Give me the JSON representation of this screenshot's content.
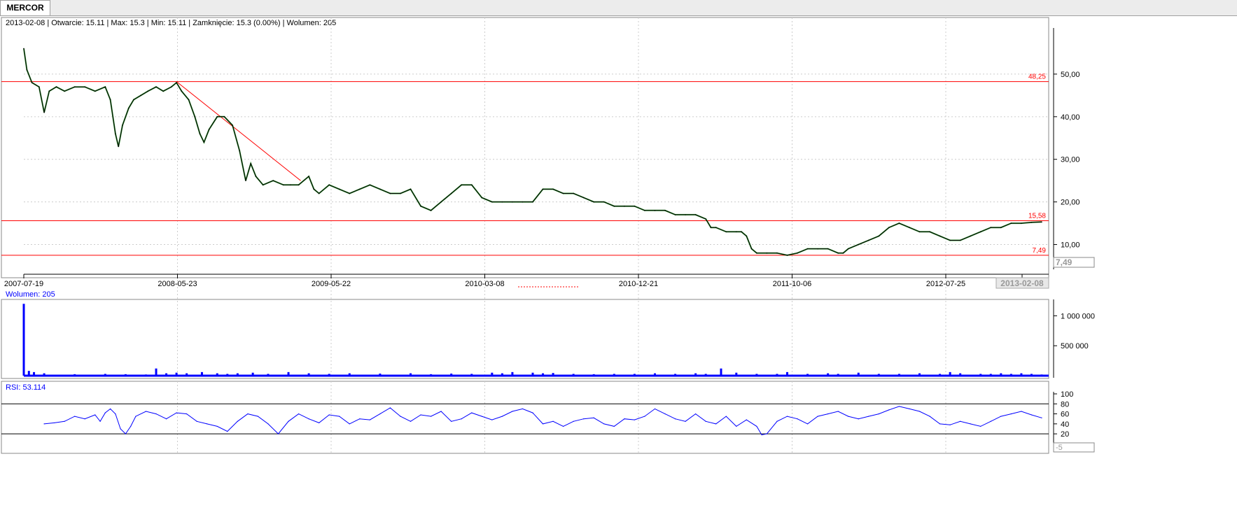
{
  "window": {
    "tab": "MERCOR"
  },
  "info": "2013-02-08 | Otwarcie: 15.11 | Max: 15.3 | Min: 15.11 | Zamknięcie: 15.3 (0.00%)  | Wolumen: 205",
  "colors": {
    "price": "#000000",
    "avg": "#008000",
    "hline": "#ff0000",
    "volume": "#0000ff",
    "rsi": "#0000ff"
  },
  "chart_data": [
    {
      "type": "line",
      "title": "",
      "x_ticks": [
        "2007-07-19",
        "2008-05-23",
        "2009-05-22",
        "2010-03-08",
        "2010-12-21",
        "2011-10-06",
        "2012-07-25",
        "2013-02-08"
      ],
      "ylim": [
        5,
        60
      ],
      "y_ticks": [
        {
          "value": 10,
          "label": "10,00"
        },
        {
          "value": 20,
          "label": "20,00"
        },
        {
          "value": 30,
          "label": "30,00"
        },
        {
          "value": 40,
          "label": "40,00"
        },
        {
          "value": 50,
          "label": "50,00"
        }
      ],
      "current_value_label": "7,49",
      "date_label": "2013-02-08",
      "hlines": [
        {
          "value": 48.25,
          "label": "48,25"
        },
        {
          "value": 15.58,
          "label": "15,58"
        },
        {
          "value": 7.49,
          "label": "7,49"
        }
      ],
      "trendline": {
        "from": [
          0.15,
          48.25
        ],
        "to": [
          0.272,
          25.0
        ]
      },
      "series": [
        {
          "values": [
            [
              0.0,
              56
            ],
            [
              0.003,
              51
            ],
            [
              0.008,
              48
            ],
            [
              0.015,
              47
            ],
            [
              0.02,
              41
            ],
            [
              0.025,
              46
            ],
            [
              0.032,
              47
            ],
            [
              0.04,
              46
            ],
            [
              0.05,
              47
            ],
            [
              0.06,
              47
            ],
            [
              0.07,
              46
            ],
            [
              0.08,
              47
            ],
            [
              0.085,
              44
            ],
            [
              0.09,
              36
            ],
            [
              0.093,
              33
            ],
            [
              0.097,
              38
            ],
            [
              0.103,
              42
            ],
            [
              0.108,
              44
            ],
            [
              0.115,
              45
            ],
            [
              0.122,
              46
            ],
            [
              0.13,
              47
            ],
            [
              0.137,
              46
            ],
            [
              0.145,
              47
            ],
            [
              0.15,
              48
            ],
            [
              0.155,
              46
            ],
            [
              0.162,
              44
            ],
            [
              0.168,
              40
            ],
            [
              0.173,
              36
            ],
            [
              0.177,
              34
            ],
            [
              0.182,
              37
            ],
            [
              0.19,
              40
            ],
            [
              0.197,
              40
            ],
            [
              0.205,
              38
            ],
            [
              0.212,
              32
            ],
            [
              0.218,
              25
            ],
            [
              0.223,
              29
            ],
            [
              0.228,
              26
            ],
            [
              0.235,
              24
            ],
            [
              0.245,
              25
            ],
            [
              0.255,
              24
            ],
            [
              0.262,
              24
            ],
            [
              0.27,
              24
            ],
            [
              0.28,
              26
            ],
            [
              0.285,
              23
            ],
            [
              0.29,
              22
            ],
            [
              0.3,
              24
            ],
            [
              0.31,
              23
            ],
            [
              0.32,
              22
            ],
            [
              0.33,
              23
            ],
            [
              0.34,
              24
            ],
            [
              0.35,
              23
            ],
            [
              0.36,
              22
            ],
            [
              0.37,
              22
            ],
            [
              0.38,
              23
            ],
            [
              0.39,
              19
            ],
            [
              0.4,
              18
            ],
            [
              0.41,
              20
            ],
            [
              0.42,
              22
            ],
            [
              0.43,
              24
            ],
            [
              0.44,
              24
            ],
            [
              0.45,
              21
            ],
            [
              0.46,
              20
            ],
            [
              0.47,
              20
            ],
            [
              0.48,
              20
            ],
            [
              0.49,
              20
            ],
            [
              0.5,
              20
            ],
            [
              0.51,
              23
            ],
            [
              0.52,
              23
            ],
            [
              0.53,
              22
            ],
            [
              0.54,
              22
            ],
            [
              0.55,
              21
            ],
            [
              0.56,
              20
            ],
            [
              0.57,
              20
            ],
            [
              0.58,
              19
            ],
            [
              0.59,
              19
            ],
            [
              0.6,
              19
            ],
            [
              0.61,
              18
            ],
            [
              0.62,
              18
            ],
            [
              0.63,
              18
            ],
            [
              0.64,
              17
            ],
            [
              0.65,
              17
            ],
            [
              0.66,
              17
            ],
            [
              0.67,
              16
            ],
            [
              0.675,
              14
            ],
            [
              0.68,
              14
            ],
            [
              0.69,
              13
            ],
            [
              0.7,
              13
            ],
            [
              0.705,
              13
            ],
            [
              0.71,
              12
            ],
            [
              0.715,
              9
            ],
            [
              0.72,
              8
            ],
            [
              0.73,
              8
            ],
            [
              0.74,
              8
            ],
            [
              0.75,
              7.5
            ],
            [
              0.76,
              8
            ],
            [
              0.77,
              9
            ],
            [
              0.78,
              9
            ],
            [
              0.79,
              9
            ],
            [
              0.8,
              8
            ],
            [
              0.805,
              8
            ],
            [
              0.81,
              9
            ],
            [
              0.82,
              10
            ],
            [
              0.83,
              11
            ],
            [
              0.84,
              12
            ],
            [
              0.85,
              14
            ],
            [
              0.86,
              15
            ],
            [
              0.87,
              14
            ],
            [
              0.88,
              13
            ],
            [
              0.89,
              13
            ],
            [
              0.9,
              12
            ],
            [
              0.91,
              11
            ],
            [
              0.92,
              11
            ],
            [
              0.93,
              12
            ],
            [
              0.94,
              13
            ],
            [
              0.95,
              14
            ],
            [
              0.96,
              14
            ],
            [
              0.97,
              15
            ],
            [
              0.98,
              15
            ],
            [
              0.99,
              15.2
            ],
            [
              1.0,
              15.3
            ]
          ]
        }
      ]
    },
    {
      "type": "bar",
      "label": "Wolumen: 205",
      "ylim": [
        0,
        1250000
      ],
      "y_ticks": [
        {
          "value": 500000,
          "label": "500 000"
        },
        {
          "value": 1000000,
          "label": "1 000 000"
        }
      ],
      "values": [
        [
          0.0,
          1200000
        ],
        [
          0.005,
          80000
        ],
        [
          0.01,
          60000
        ],
        [
          0.02,
          40000
        ],
        [
          0.05,
          25000
        ],
        [
          0.08,
          30000
        ],
        [
          0.1,
          25000
        ],
        [
          0.12,
          20000
        ],
        [
          0.13,
          120000
        ],
        [
          0.14,
          40000
        ],
        [
          0.15,
          50000
        ],
        [
          0.16,
          40000
        ],
        [
          0.175,
          60000
        ],
        [
          0.19,
          40000
        ],
        [
          0.2,
          30000
        ],
        [
          0.21,
          40000
        ],
        [
          0.225,
          50000
        ],
        [
          0.24,
          30000
        ],
        [
          0.26,
          60000
        ],
        [
          0.28,
          40000
        ],
        [
          0.3,
          30000
        ],
        [
          0.32,
          40000
        ],
        [
          0.35,
          35000
        ],
        [
          0.38,
          40000
        ],
        [
          0.4,
          25000
        ],
        [
          0.42,
          35000
        ],
        [
          0.44,
          30000
        ],
        [
          0.46,
          50000
        ],
        [
          0.47,
          40000
        ],
        [
          0.48,
          60000
        ],
        [
          0.5,
          50000
        ],
        [
          0.51,
          40000
        ],
        [
          0.52,
          45000
        ],
        [
          0.54,
          30000
        ],
        [
          0.56,
          25000
        ],
        [
          0.58,
          30000
        ],
        [
          0.6,
          30000
        ],
        [
          0.62,
          40000
        ],
        [
          0.64,
          30000
        ],
        [
          0.66,
          40000
        ],
        [
          0.67,
          30000
        ],
        [
          0.685,
          120000
        ],
        [
          0.7,
          50000
        ],
        [
          0.72,
          30000
        ],
        [
          0.74,
          30000
        ],
        [
          0.75,
          60000
        ],
        [
          0.77,
          30000
        ],
        [
          0.79,
          40000
        ],
        [
          0.8,
          30000
        ],
        [
          0.82,
          50000
        ],
        [
          0.84,
          30000
        ],
        [
          0.86,
          30000
        ],
        [
          0.88,
          40000
        ],
        [
          0.9,
          30000
        ],
        [
          0.91,
          60000
        ],
        [
          0.92,
          40000
        ],
        [
          0.94,
          30000
        ],
        [
          0.95,
          30000
        ],
        [
          0.96,
          40000
        ],
        [
          0.97,
          30000
        ],
        [
          0.98,
          40000
        ],
        [
          0.99,
          30000
        ],
        [
          1.0,
          20000
        ]
      ]
    },
    {
      "type": "line",
      "label": "RSI: 53.114",
      "ylim": [
        -5,
        100
      ],
      "y_ticks": [
        {
          "value": 20,
          "label": "20"
        },
        {
          "value": 40,
          "label": "40"
        },
        {
          "value": 60,
          "label": "60"
        },
        {
          "value": 80,
          "label": "80"
        },
        {
          "value": 100,
          "label": "100"
        }
      ],
      "current_value_label": "-5",
      "hlines": [
        80,
        20
      ],
      "values": [
        [
          0.02,
          40
        ],
        [
          0.03,
          42
        ],
        [
          0.04,
          45
        ],
        [
          0.05,
          55
        ],
        [
          0.06,
          50
        ],
        [
          0.07,
          58
        ],
        [
          0.075,
          45
        ],
        [
          0.08,
          62
        ],
        [
          0.085,
          70
        ],
        [
          0.09,
          60
        ],
        [
          0.095,
          30
        ],
        [
          0.1,
          20
        ],
        [
          0.105,
          35
        ],
        [
          0.11,
          55
        ],
        [
          0.12,
          65
        ],
        [
          0.13,
          60
        ],
        [
          0.14,
          50
        ],
        [
          0.15,
          62
        ],
        [
          0.16,
          60
        ],
        [
          0.17,
          45
        ],
        [
          0.18,
          40
        ],
        [
          0.19,
          35
        ],
        [
          0.2,
          25
        ],
        [
          0.21,
          45
        ],
        [
          0.22,
          60
        ],
        [
          0.23,
          55
        ],
        [
          0.24,
          40
        ],
        [
          0.25,
          20
        ],
        [
          0.26,
          45
        ],
        [
          0.27,
          60
        ],
        [
          0.28,
          50
        ],
        [
          0.29,
          42
        ],
        [
          0.3,
          58
        ],
        [
          0.31,
          55
        ],
        [
          0.32,
          40
        ],
        [
          0.33,
          50
        ],
        [
          0.34,
          48
        ],
        [
          0.35,
          60
        ],
        [
          0.36,
          72
        ],
        [
          0.37,
          55
        ],
        [
          0.38,
          45
        ],
        [
          0.39,
          58
        ],
        [
          0.4,
          55
        ],
        [
          0.41,
          65
        ],
        [
          0.42,
          45
        ],
        [
          0.43,
          50
        ],
        [
          0.44,
          62
        ],
        [
          0.45,
          55
        ],
        [
          0.46,
          48
        ],
        [
          0.47,
          55
        ],
        [
          0.48,
          65
        ],
        [
          0.49,
          70
        ],
        [
          0.5,
          62
        ],
        [
          0.51,
          40
        ],
        [
          0.52,
          45
        ],
        [
          0.53,
          35
        ],
        [
          0.54,
          45
        ],
        [
          0.55,
          50
        ],
        [
          0.56,
          52
        ],
        [
          0.57,
          40
        ],
        [
          0.58,
          35
        ],
        [
          0.59,
          50
        ],
        [
          0.6,
          48
        ],
        [
          0.61,
          55
        ],
        [
          0.62,
          70
        ],
        [
          0.63,
          60
        ],
        [
          0.64,
          50
        ],
        [
          0.65,
          45
        ],
        [
          0.66,
          60
        ],
        [
          0.67,
          45
        ],
        [
          0.68,
          40
        ],
        [
          0.69,
          55
        ],
        [
          0.7,
          35
        ],
        [
          0.71,
          48
        ],
        [
          0.72,
          35
        ],
        [
          0.725,
          18
        ],
        [
          0.73,
          20
        ],
        [
          0.74,
          45
        ],
        [
          0.75,
          55
        ],
        [
          0.76,
          50
        ],
        [
          0.77,
          40
        ],
        [
          0.78,
          55
        ],
        [
          0.79,
          60
        ],
        [
          0.8,
          65
        ],
        [
          0.81,
          55
        ],
        [
          0.82,
          50
        ],
        [
          0.83,
          55
        ],
        [
          0.84,
          60
        ],
        [
          0.85,
          68
        ],
        [
          0.86,
          75
        ],
        [
          0.87,
          70
        ],
        [
          0.88,
          65
        ],
        [
          0.89,
          55
        ],
        [
          0.9,
          40
        ],
        [
          0.91,
          38
        ],
        [
          0.92,
          45
        ],
        [
          0.93,
          40
        ],
        [
          0.94,
          35
        ],
        [
          0.95,
          45
        ],
        [
          0.96,
          55
        ],
        [
          0.97,
          60
        ],
        [
          0.98,
          65
        ],
        [
          0.99,
          58
        ],
        [
          1.0,
          52
        ]
      ]
    }
  ]
}
